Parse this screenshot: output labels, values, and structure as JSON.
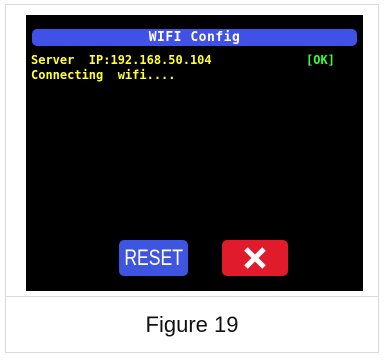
{
  "screen": {
    "title": "WIFI Config",
    "server_line": "Server  IP:192.168.50.104",
    "server_status": "[OK]",
    "status_line": "Connecting  wifi....",
    "reset_label": "RESET",
    "close_icon": "close-x"
  },
  "caption": "Figure 19",
  "colors": {
    "screen_bg": "#000000",
    "title_bar": "#3f51e6",
    "text_yellow": "#ffff33",
    "ok_green": "#33ff33",
    "reset_button": "#3e55e0",
    "close_button": "#e01b2c"
  }
}
